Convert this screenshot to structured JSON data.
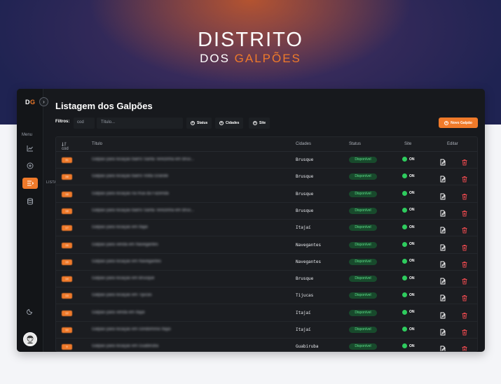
{
  "brand": {
    "line1": "DISTRITO",
    "line2_a": "DOS ",
    "line2_b": "GALPÕES"
  },
  "sidebar": {
    "logo_a": "D",
    "logo_b": "G",
    "menu_label": "Menu",
    "active_tooltip": "LISTAGEM",
    "icons": [
      "chart-icon",
      "add-circle-icon",
      "list-icon",
      "database-icon",
      "moon-icon",
      "avatar"
    ]
  },
  "page": {
    "title": "Listagem dos Galpões"
  },
  "filters": {
    "label": "Filtros:",
    "cod_placeholder": "cod",
    "title_placeholder": "Título...",
    "status_label": "Status",
    "cities_label": "Cidades",
    "site_label": "Site",
    "new_button": "Novo Galpão"
  },
  "table": {
    "headers": {
      "cod": "cod",
      "title": "Título",
      "city": "Cidades",
      "status": "Status",
      "site": "Site",
      "edit": "Editar"
    },
    "rows": [
      {
        "cod": "31",
        "title": "Galpão para locação bairro Santa Terezinha em Brus...",
        "city": "Brusque",
        "status": "Disponível",
        "site": "ON"
      },
      {
        "cod": "28",
        "title": "Galpão para locação bairro Volta Grande",
        "city": "Brusque",
        "status": "Disponível",
        "site": "ON"
      },
      {
        "cod": "18",
        "title": "Galpão para locação na Rua da Fazenda",
        "city": "Brusque",
        "status": "Disponível",
        "site": "ON"
      },
      {
        "cod": "18",
        "title": "Galpão para locação bairro Santa Terezinha em Brus...",
        "city": "Brusque",
        "status": "Disponível",
        "site": "ON"
      },
      {
        "cod": "17",
        "title": "Galpão para locação em Itajaí",
        "city": "Itajaí",
        "status": "Disponível",
        "site": "ON"
      },
      {
        "cod": "16",
        "title": "Galpão para venda em Navegantes",
        "city": "Navegantes",
        "status": "Disponível",
        "site": "ON"
      },
      {
        "cod": "15",
        "title": "Galpão para locação em Navegantes",
        "city": "Navegantes",
        "status": "Disponível",
        "site": "ON"
      },
      {
        "cod": "14",
        "title": "Galpão para locação em Brusque",
        "city": "Brusque",
        "status": "Disponível",
        "site": "ON"
      },
      {
        "cod": "13",
        "title": "Galpão para locação em Tijucas",
        "city": "Tijucas",
        "status": "Disponível",
        "site": "ON"
      },
      {
        "cod": "12",
        "title": "Galpão para venda em Itajaí",
        "city": "Itajaí",
        "status": "Disponível",
        "site": "ON"
      },
      {
        "cod": "10",
        "title": "Galpão para locação em condomínio Itajaí",
        "city": "Itajaí",
        "status": "Disponível",
        "site": "ON"
      },
      {
        "cod": "9",
        "title": "Galpão para locação em Guabiruba",
        "city": "Guabiruba",
        "status": "Disponível",
        "site": "ON"
      }
    ]
  },
  "colors": {
    "accent": "#f07a2a",
    "hero_bg": "#1f2352",
    "app_bg": "#17191d",
    "status_bg": "#184a2c",
    "status_text": "#5de08a",
    "online": "#2ecc5e",
    "delete": "#e5484d"
  }
}
